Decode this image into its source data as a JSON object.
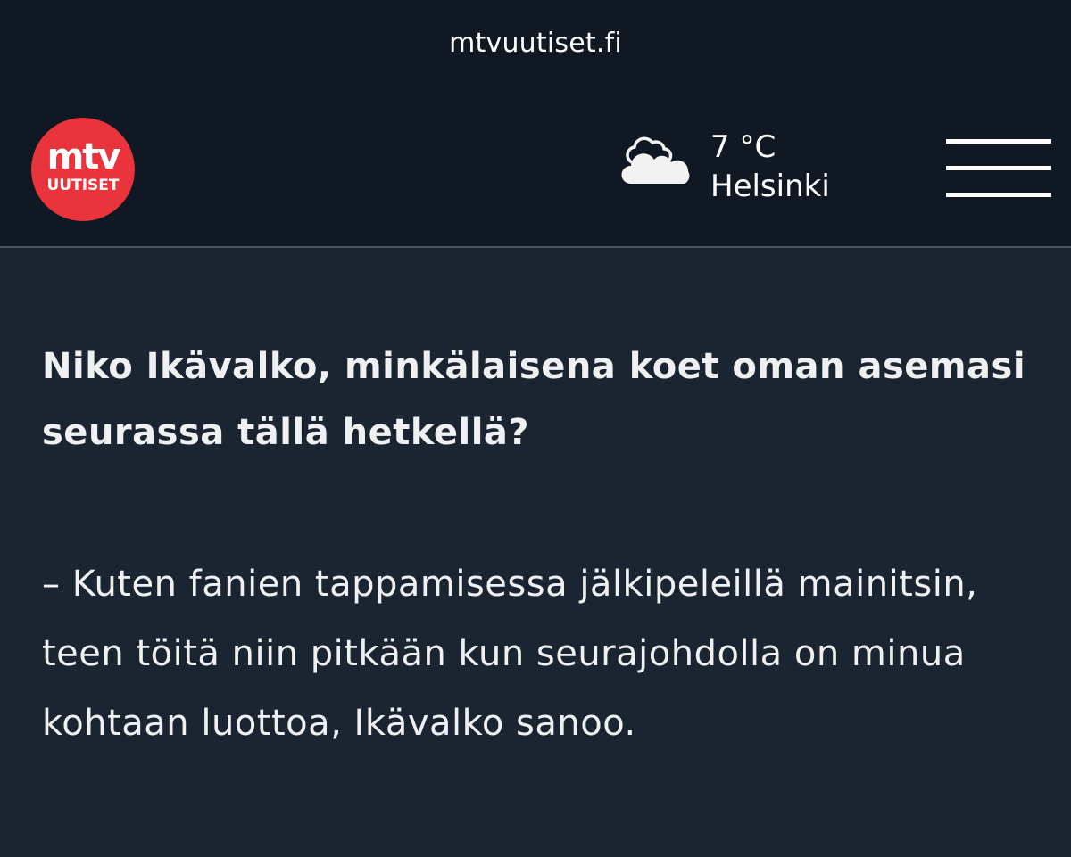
{
  "browser": {
    "url": "mtvuutiset.fi"
  },
  "header": {
    "logo": {
      "brand": "mtv",
      "sub": "UUTISET",
      "color": "#e8343a"
    },
    "weather": {
      "icon": "cloudy-icon",
      "temperature": "7 °C",
      "city": "Helsinki"
    },
    "menu_icon": "hamburger-menu-icon"
  },
  "article": {
    "question": "Niko Ikävalko, minkälaisena koet oman asemasi seurassa tällä hetkellä?",
    "answer": "– Kuten fanien tappamisessa jälkipeleillä mainitsin, teen töitä niin pitkään kun seurajohdolla on minua kohtaan luottoa, Ikävalko sanoo."
  },
  "colors": {
    "header_bg": "#0f1823",
    "content_bg": "#1b2531",
    "text": "#eef0f2"
  }
}
